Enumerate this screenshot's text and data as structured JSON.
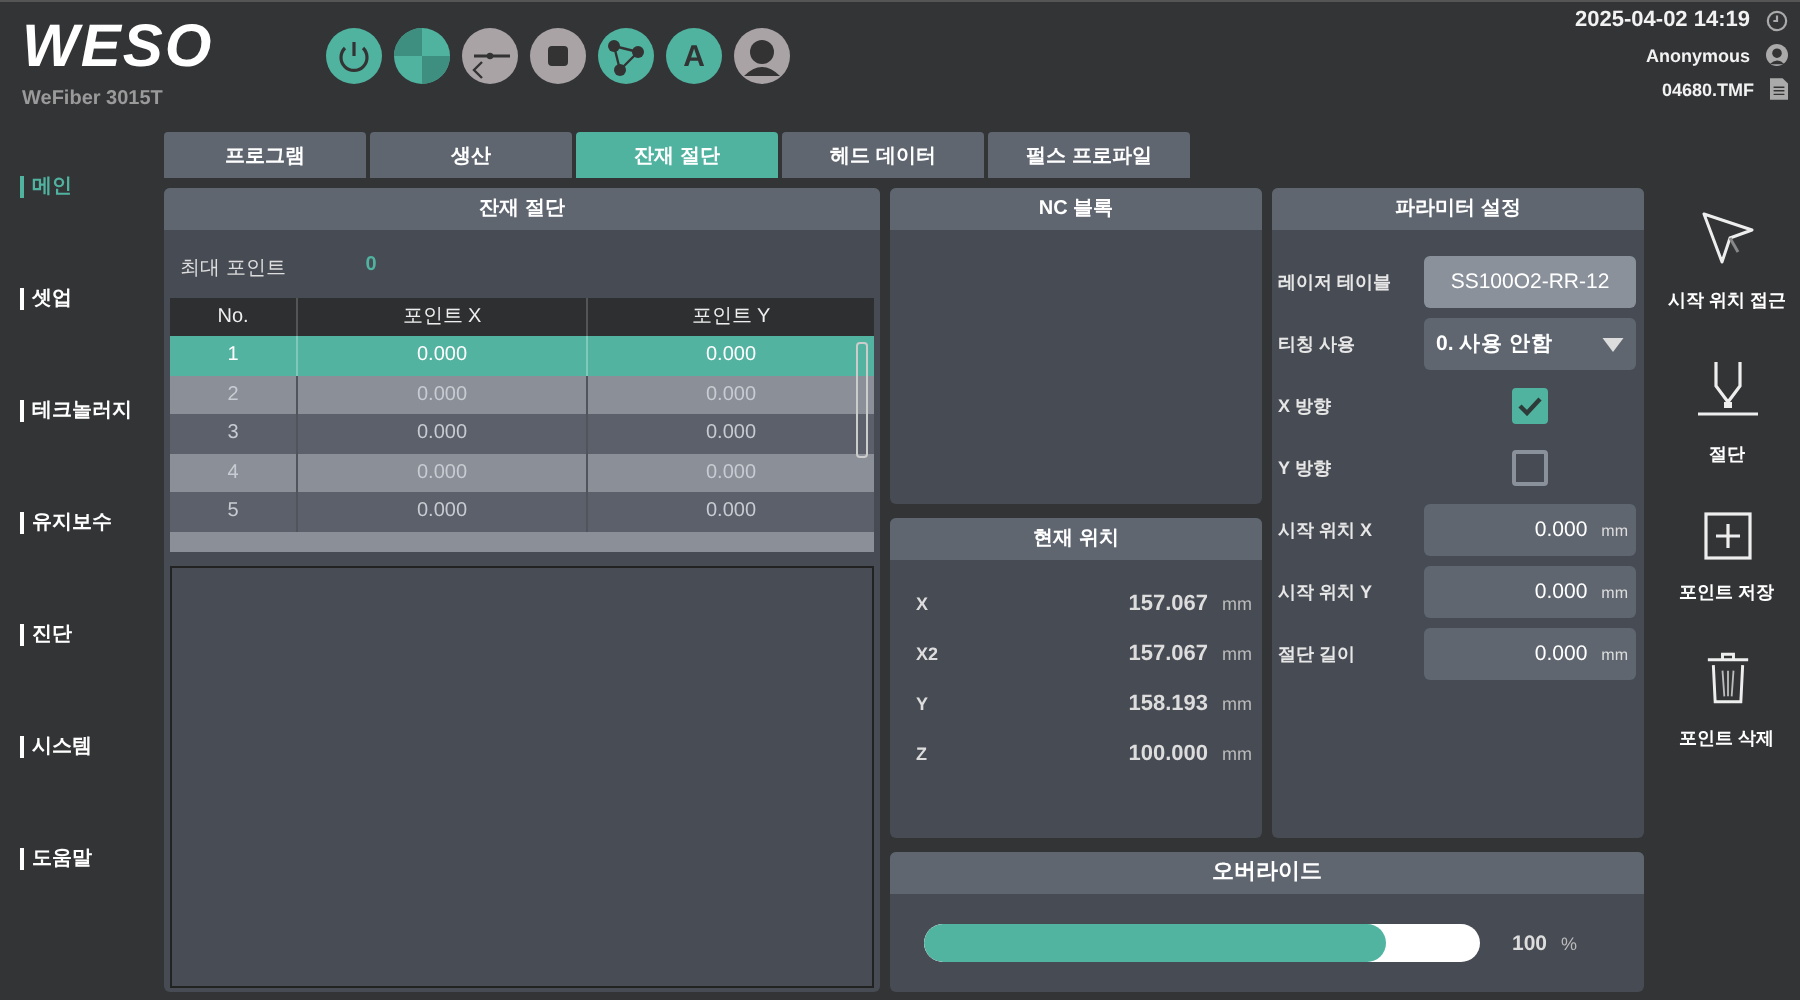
{
  "header": {
    "logo": "WESO",
    "model": "WeFiber 3015T",
    "toolbar": [
      {
        "kind": "power",
        "active": true
      },
      {
        "kind": "pie",
        "active": true
      },
      {
        "kind": "back",
        "active": false
      },
      {
        "kind": "stop",
        "active": false
      },
      {
        "kind": "network",
        "active": true
      },
      {
        "kind": "letter",
        "label": "A",
        "active": true
      },
      {
        "kind": "user",
        "active": false
      }
    ],
    "status": [
      {
        "kind": "clock",
        "text": "2025-04-02 14:19"
      },
      {
        "kind": "user",
        "text": "Anonymous"
      },
      {
        "kind": "file",
        "text": "04680.TMF"
      }
    ]
  },
  "sidebar": {
    "items": [
      {
        "label": "메인",
        "selected": true
      },
      {
        "label": "셋업",
        "selected": false
      },
      {
        "label": "테크놀러지",
        "selected": false
      },
      {
        "label": "유지보수",
        "selected": false
      },
      {
        "label": "진단",
        "selected": false
      },
      {
        "label": "시스템",
        "selected": false
      },
      {
        "label": "도움말",
        "selected": false
      }
    ]
  },
  "tabs": [
    {
      "label": "프로그램",
      "selected": false
    },
    {
      "label": "생산",
      "selected": false
    },
    {
      "label": "잔재 절단",
      "selected": true
    },
    {
      "label": "헤드 데이터",
      "selected": false
    },
    {
      "label": "펄스 프로파일",
      "selected": false
    }
  ],
  "remnant_panel": {
    "title": "잔재 절단",
    "max_points_label": "최대 포인트",
    "max_points": "0",
    "table": {
      "columns": [
        "No.",
        "포인트 X",
        "포인트 Y"
      ],
      "rows": [
        {
          "cells": [
            "1",
            "0.000",
            "0.000"
          ],
          "selected": true
        },
        {
          "cells": [
            "2",
            "0.000",
            "0.000"
          ],
          "selected": false
        },
        {
          "cells": [
            "3",
            "0.000",
            "0.000"
          ],
          "selected": false
        },
        {
          "cells": [
            "4",
            "0.000",
            "0.000"
          ],
          "selected": false
        },
        {
          "cells": [
            "5",
            "0.000",
            "0.000"
          ],
          "selected": false
        }
      ]
    }
  },
  "nc_panel": {
    "title": "NC 블록"
  },
  "position_panel": {
    "title": "현재 위치",
    "rows": [
      {
        "axis": "X",
        "value": "157.067",
        "unit": "mm"
      },
      {
        "axis": "X2",
        "value": "157.067",
        "unit": "mm"
      },
      {
        "axis": "Y",
        "value": "158.193",
        "unit": "mm"
      },
      {
        "axis": "Z",
        "value": "100.000",
        "unit": "mm"
      }
    ]
  },
  "param_panel": {
    "title": "파라미터 설정",
    "rows": [
      {
        "kind": "button",
        "label": "레이저 테이블",
        "value": "SS100O2-RR-12"
      },
      {
        "kind": "dropdown",
        "label": "티칭 사용",
        "value": "0. 사용 안함"
      },
      {
        "kind": "checkbox",
        "label": "X 방향",
        "checked": true
      },
      {
        "kind": "checkbox",
        "label": "Y 방향",
        "checked": false
      },
      {
        "kind": "number",
        "label": "시작 위치 X",
        "value": "0.000",
        "unit": "mm"
      },
      {
        "kind": "number",
        "label": "시작 위치 Y",
        "value": "0.000",
        "unit": "mm"
      },
      {
        "kind": "number",
        "label": "절단 길이",
        "value": "0.000",
        "unit": "mm"
      }
    ]
  },
  "override_panel": {
    "title": "오버라이드",
    "level": 0.83,
    "reading": "100",
    "unit": "%"
  },
  "actions": [
    {
      "kind": "cursor",
      "label": "시작 위치 접근"
    },
    {
      "kind": "nozzle",
      "label": "절단"
    },
    {
      "kind": "plus",
      "label": "포인트 저장"
    },
    {
      "kind": "trash",
      "label": "포인트 삭제"
    }
  ]
}
